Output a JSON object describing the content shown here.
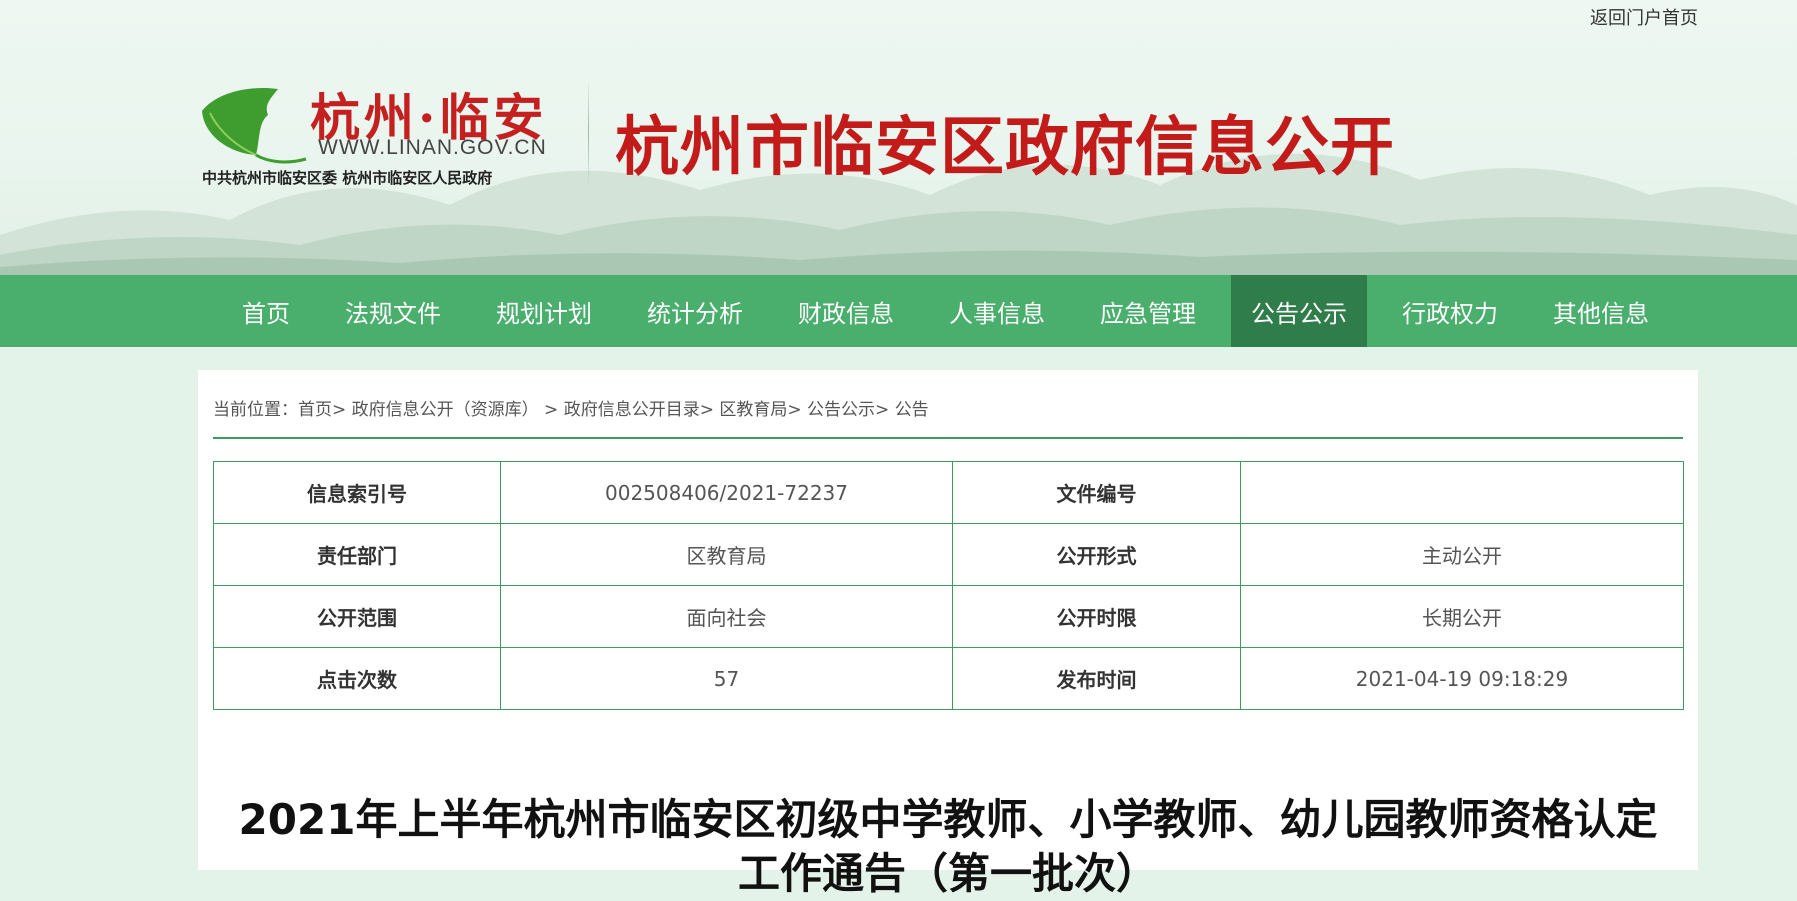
{
  "header": {
    "portal_link": "返回门户首页",
    "logo_brand": "杭州·临安",
    "logo_url": "WWW.LINAN.GOV.CN",
    "logo_orgs": "中共杭州市临安区委  杭州市临安区人民政府",
    "site_title": "杭州市临安区政府信息公开"
  },
  "nav": {
    "items": [
      "首页",
      "法规文件",
      "规划计划",
      "统计分析",
      "财政信息",
      "人事信息",
      "应急管理",
      "公告公示",
      "行政权力",
      "其他信息"
    ],
    "active_index": 7
  },
  "breadcrumb": {
    "prefix": "当前位置：",
    "items": [
      "首页",
      "政府信息公开（资源库）",
      "政府信息公开目录",
      "区教育局",
      "公告公示",
      "公告"
    ]
  },
  "meta": {
    "rows": [
      {
        "k1": "信息索引号",
        "v1": "002508406/2021-72237",
        "k2": "文件编号",
        "v2": ""
      },
      {
        "k1": "责任部门",
        "v1": "区教育局",
        "k2": "公开形式",
        "v2": "主动公开"
      },
      {
        "k1": "公开范围",
        "v1": "面向社会",
        "k2": "公开时限",
        "v2": "长期公开"
      },
      {
        "k1": "点击次数",
        "v1": "57",
        "k2": "发布时间",
        "v2": "2021-04-19 09:18:29"
      }
    ]
  },
  "document": {
    "title_line1": "2021年上半年杭州市临安区初级中学教师、小学教师、幼儿园教师资格认定",
    "title_line2": "工作通告（第一批次）"
  },
  "colors": {
    "nav_bg": "#4aae6d",
    "nav_active": "#2f7d4a",
    "title_red": "#c31a1a",
    "table_border": "#3c9c5e",
    "page_bg": "#e4f3e9"
  }
}
